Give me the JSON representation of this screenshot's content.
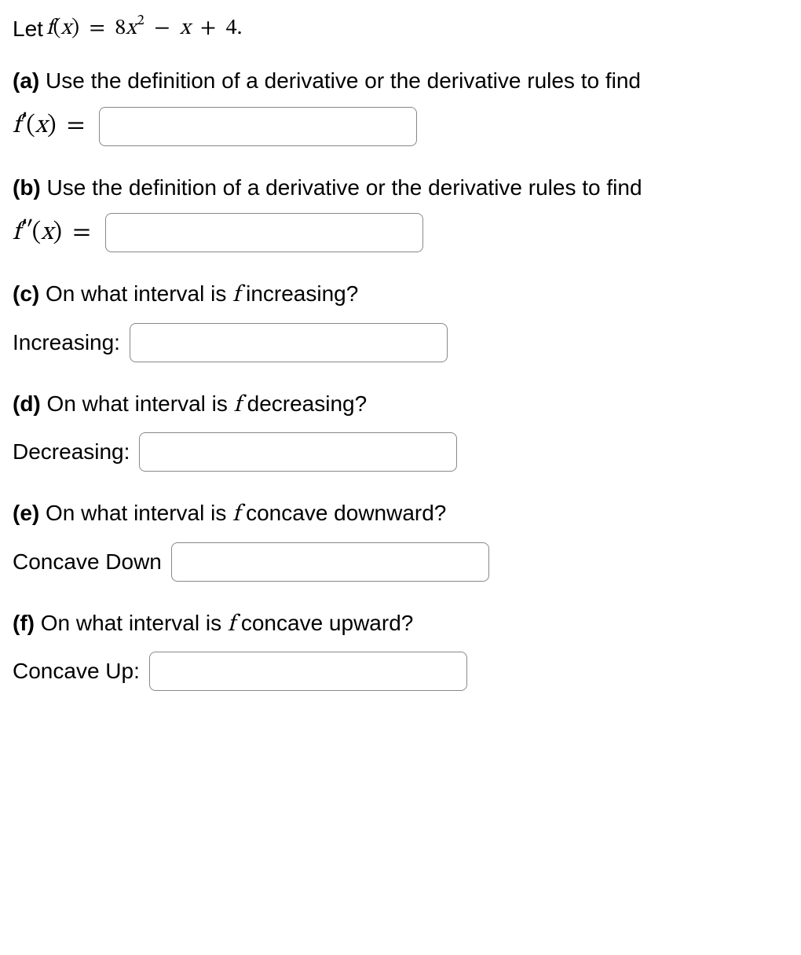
{
  "intro": {
    "let": "Let ",
    "f": "f",
    "open": "(",
    "x": "x",
    "close": ")",
    "eq": "=",
    "coef1": "8",
    "xsq": "x",
    "pow": "2",
    "minus": "−",
    "x2": "x",
    "plus": "+",
    "const": "4",
    "period": "."
  },
  "a": {
    "label": "(a)",
    "text": " Use the definition of a derivative or the derivative rules to find",
    "f": "f",
    "prime": "′",
    "open": "(",
    "x": "x",
    "close": ")",
    "eq": "="
  },
  "b": {
    "label": "(b)",
    "text": " Use the definition of a derivative or the derivative rules to find",
    "f": "f",
    "prime": "′′",
    "open": "(",
    "x": "x",
    "close": ")",
    "eq": "="
  },
  "c": {
    "label": "(c)",
    "text1": " On what interval is ",
    "f": "f",
    "text2": " increasing?",
    "answer_label": "Increasing:"
  },
  "d": {
    "label": "(d)",
    "text1": " On what interval is ",
    "f": "f",
    "text2": " decreasing?",
    "answer_label": "Decreasing:"
  },
  "e": {
    "label": "(e)",
    "text1": " On what interval is ",
    "f": "f",
    "text2": " concave downward?",
    "answer_label": "Concave Down"
  },
  "ff": {
    "label": "(f)",
    "text1": " On what interval is ",
    "f": "f",
    "text2": " concave upward?",
    "answer_label": "Concave Up:"
  }
}
